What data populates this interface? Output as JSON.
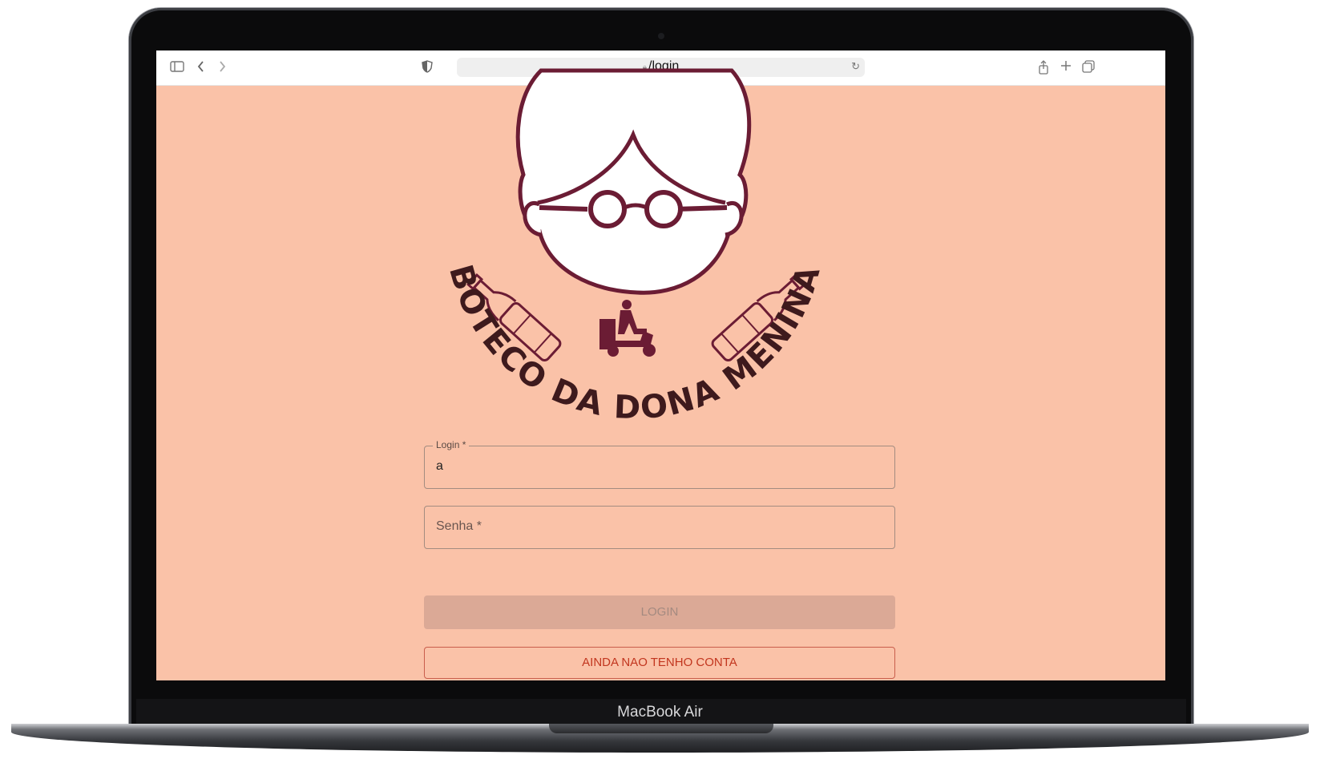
{
  "device": {
    "label": "MacBook Air"
  },
  "browser": {
    "url": "/login",
    "toolbar_icons": [
      "sidebar-icon",
      "back-icon",
      "forward-icon",
      "shield-icon",
      "lock-icon",
      "reload-icon",
      "share-icon",
      "new-tab-icon",
      "tabs-icon"
    ]
  },
  "logo": {
    "text": "BOTECO DA DONA MENINA"
  },
  "colors": {
    "page_background": "#fac2a8",
    "brand": "#6b1c34",
    "primary_disabled": "#dba996",
    "secondary_outline": "#c2361f"
  },
  "form": {
    "login": {
      "label": "Login *",
      "value": "a"
    },
    "password": {
      "placeholder": "Senha *",
      "value": ""
    },
    "login_button": {
      "label": "LOGIN",
      "disabled": true
    },
    "signup_button": {
      "label": "AINDA NAO TENHO CONTA"
    }
  }
}
